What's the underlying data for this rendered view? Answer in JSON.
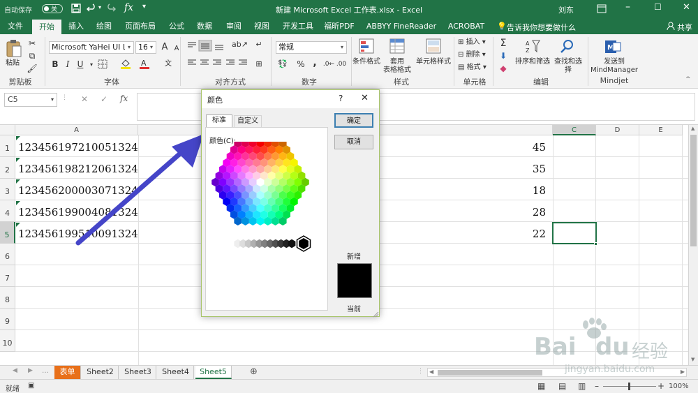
{
  "titlebar": {
    "autosave_label": "自动保存",
    "autosave_state": "关",
    "fx_glyph": "fx",
    "title": "新建 Microsoft Excel 工作表.xlsx  -  Excel",
    "user": "刘东"
  },
  "tabs": [
    "文件",
    "开始",
    "插入",
    "绘图",
    "页面布局",
    "公式",
    "数据",
    "审阅",
    "视图",
    "开发工具",
    "福昕PDF",
    "ABBYY FineReader 12",
    "ACROBAT"
  ],
  "active_tab_index": 1,
  "tell_me": "告诉我你想要做什么",
  "share": "共享",
  "ribbon": {
    "clipboard": {
      "paste": "粘贴",
      "label": "剪贴板"
    },
    "font": {
      "name": "Microsoft YaHei UI Ligh",
      "size": "16",
      "label": "字体",
      "bold": "B",
      "italic": "I",
      "underline": "U",
      "grow": "A",
      "shrink": "A",
      "fill_color": "#f5e400",
      "font_color": "#e03030"
    },
    "alignment": {
      "label": "对齐方式"
    },
    "number": {
      "format": "常规",
      "label": "数字",
      "percent": "%",
      "comma": ","
    },
    "styles": {
      "conditional": "条件格式",
      "table_format_1": "套用",
      "table_format_2": "表格格式",
      "cell_styles": "单元格样式",
      "label": "样式"
    },
    "cells": {
      "insert": "插入",
      "delete": "删除",
      "format": "格式",
      "label": "单元格"
    },
    "editing": {
      "sort_filter": "排序和筛选",
      "find_select": "查找和选择",
      "label": "编辑"
    },
    "mindjet": {
      "send_1": "发送到",
      "send_2": "MindManager",
      "label": "Mindjet"
    }
  },
  "formula_bar": {
    "name_box": "C5",
    "fx": "fx",
    "value": ""
  },
  "columns": [
    "A",
    "C",
    "D",
    "E"
  ],
  "rows": [
    "1",
    "2",
    "3",
    "4",
    "5",
    "6",
    "7",
    "8",
    "9",
    "10"
  ],
  "cells_a": [
    "123456197210051324",
    "123456198212061324",
    "123456200003071324",
    "123456199004081324",
    "123456199510091324"
  ],
  "cells_b": [
    "45",
    "35",
    "18",
    "28",
    "22"
  ],
  "sheets": [
    "表单",
    "Sheet2",
    "Sheet3",
    "Sheet4",
    "Sheet5"
  ],
  "active_sheet_index": 4,
  "status": {
    "ready": "就绪",
    "zoom": "100%"
  },
  "dialog": {
    "title": "颜色",
    "help": "?",
    "close": "✕",
    "tab_standard": "标准",
    "tab_custom": "自定义",
    "colors_label": "颜色(C):",
    "ok": "确定",
    "cancel": "取消",
    "new_label": "新增",
    "current_label": "当前",
    "selected_color": "#000000"
  },
  "colors": {
    "excel_green": "#217346",
    "arrow": "#4545c8",
    "selection": "#217346",
    "red_tab": "#e8701a"
  },
  "watermark": {
    "brand": "Bai",
    "brand2": "du",
    "cn": "经验",
    "url": "jingyan.baidu.com"
  }
}
